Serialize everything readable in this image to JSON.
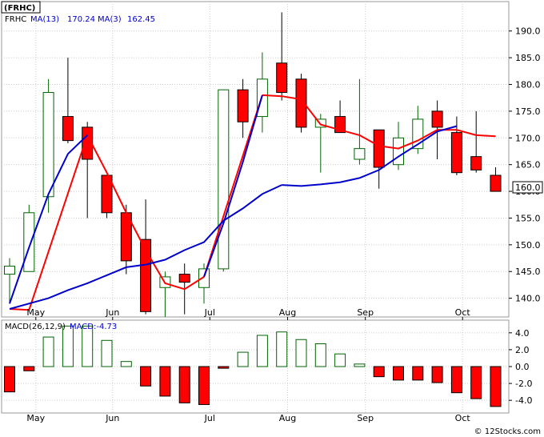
{
  "ticker_badge": "(FRHC)",
  "watermark": "© 12Stocks.com",
  "chart_data": [
    {
      "type": "candlestick",
      "legend": {
        "ticker": "FRHC",
        "ma13_label": "MA(13)",
        "ma13_value": "170.24",
        "ma3_label": "MA(3)",
        "ma3_value": "162.45"
      },
      "colors": {
        "up_fill": "#ffffff",
        "up_edge": "#006400",
        "down_fill": "#ff0000",
        "down_edge": "#000000",
        "ma3": "#ff0000",
        "ma13": "#0000cc"
      },
      "ylim": [
        136.5,
        195.5
      ],
      "yticks": [
        140.0,
        145.0,
        150.0,
        155.0,
        160.0,
        165.0,
        170.0,
        175.0,
        180.0,
        185.0,
        190.0
      ],
      "ytick_labels": [
        "140.0",
        "145.0",
        "150.0",
        "155.0",
        "160.0",
        "165.0",
        "170.0",
        "175.0",
        "180.0",
        "185.0",
        "190.0"
      ],
      "last_price": "160.0",
      "month_labels": [
        {
          "label": "May",
          "index": 1.35
        },
        {
          "label": "Jun",
          "index": 5.3
        },
        {
          "label": "Jul",
          "index": 10.3
        },
        {
          "label": "Aug",
          "index": 14.3
        },
        {
          "label": "Sep",
          "index": 18.3
        },
        {
          "label": "Oct",
          "index": 23.3
        }
      ],
      "candles": [
        {
          "o": 144.5,
          "h": 147.5,
          "l": 139.0,
          "c": 146.0
        },
        {
          "o": 145.0,
          "h": 157.5,
          "l": 145.0,
          "c": 156.0
        },
        {
          "o": 159.0,
          "h": 181.0,
          "l": 156.0,
          "c": 178.5
        },
        {
          "o": 174.0,
          "h": 185.0,
          "l": 169.0,
          "c": 169.5
        },
        {
          "o": 172.0,
          "h": 173.0,
          "l": 155.0,
          "c": 166.0
        },
        {
          "o": 163.0,
          "h": 163.0,
          "l": 155.0,
          "c": 156.0
        },
        {
          "o": 156.0,
          "h": 157.5,
          "l": 144.5,
          "c": 147.0
        },
        {
          "o": 151.0,
          "h": 158.5,
          "l": 137.0,
          "c": 137.5
        },
        {
          "o": 142.0,
          "h": 145.0,
          "l": 136.5,
          "c": 144.0
        },
        {
          "o": 144.5,
          "h": 146.5,
          "l": 137.0,
          "c": 143.0
        },
        {
          "o": 142.0,
          "h": 146.5,
          "l": 139.0,
          "c": 145.5
        },
        {
          "o": 145.5,
          "h": 179.0,
          "l": 145.0,
          "c": 179.0
        },
        {
          "o": 179.0,
          "h": 181.0,
          "l": 170.0,
          "c": 173.0
        },
        {
          "o": 174.0,
          "h": 186.0,
          "l": 171.0,
          "c": 181.0
        },
        {
          "o": 184.0,
          "h": 193.5,
          "l": 177.0,
          "c": 178.5
        },
        {
          "o": 181.0,
          "h": 182.0,
          "l": 171.0,
          "c": 172.0
        },
        {
          "o": 172.0,
          "h": 174.5,
          "l": 163.5,
          "c": 173.5
        },
        {
          "o": 174.0,
          "h": 177.0,
          "l": 171.0,
          "c": 171.0
        },
        {
          "o": 166.0,
          "h": 181.0,
          "l": 165.0,
          "c": 168.0
        },
        {
          "o": 171.5,
          "h": 171.5,
          "l": 160.5,
          "c": 164.5
        },
        {
          "o": 165.0,
          "h": 173.0,
          "l": 164.0,
          "c": 170.0
        },
        {
          "o": 168.0,
          "h": 176.0,
          "l": 167.0,
          "c": 173.5
        },
        {
          "o": 175.0,
          "h": 177.0,
          "l": 166.0,
          "c": 172.0
        },
        {
          "o": 171.0,
          "h": 174.0,
          "l": 163.0,
          "c": 163.5
        },
        {
          "o": 166.5,
          "h": 175.0,
          "l": 163.5,
          "c": 164.0
        },
        {
          "o": 163.0,
          "h": 164.5,
          "l": 160.0,
          "c": 160.0
        }
      ],
      "ma3": [
        138.0,
        137.8,
        null,
        null,
        170.5,
        163.5,
        156.0,
        149.0,
        142.8,
        141.7,
        144.0,
        null,
        null,
        178.0,
        177.8,
        177.2,
        172.5,
        171.5,
        170.5,
        168.5,
        168.0,
        169.5,
        171.5,
        171.5,
        170.5,
        170.3
      ],
      "ma13": [
        null,
        null,
        null,
        null,
        null,
        null,
        null,
        null,
        null,
        null,
        null,
        null,
        null,
        null,
        161.2,
        161.0,
        161.3,
        161.7,
        162.5,
        164.0,
        166.5,
        168.8,
        171.2,
        172.2,
        null,
        null
      ],
      "ma13_early": [
        139.0,
        149.5,
        159.5,
        167.0,
        170.5
      ],
      "ma13_mid": [
        {
          "i": 0,
          "v": 138.0
        },
        {
          "i": 2,
          "v": 140.0
        },
        {
          "i": 3,
          "v": 141.5
        },
        {
          "i": 4,
          "v": 142.8
        },
        {
          "i": 5,
          "v": 144.3
        },
        {
          "i": 6,
          "v": 145.8
        },
        {
          "i": 7,
          "v": 146.3
        },
        {
          "i": 8,
          "v": 147.2
        },
        {
          "i": 9,
          "v": 149.0
        },
        {
          "i": 10,
          "v": 150.5
        },
        {
          "i": 11,
          "v": 154.5
        },
        {
          "i": 12,
          "v": 156.8
        },
        {
          "i": 13,
          "v": 159.5
        },
        {
          "i": 14,
          "v": 161.2
        }
      ],
      "ma13_rise": [
        {
          "i": 10,
          "v": 144.0
        },
        {
          "i": 11,
          "v": 154.0
        },
        {
          "i": 12,
          "v": 165.5
        },
        {
          "i": 13,
          "v": 178.0
        }
      ]
    },
    {
      "type": "bar",
      "title": "MACD(26,12,9)",
      "value_label": "MACD:-4.73",
      "ylim": [
        -5.5,
        5.5
      ],
      "yticks": [
        4.0,
        2.0,
        0.0,
        -2.0,
        -4.0
      ],
      "ytick_labels": [
        "4.0",
        "2.0",
        "0.0",
        "-2.0",
        "-4.0"
      ],
      "values": [
        -3.0,
        -0.5,
        3.5,
        4.8,
        4.8,
        3.1,
        0.6,
        -2.3,
        -3.5,
        -4.3,
        -4.5,
        -0.2,
        1.7,
        3.7,
        4.1,
        3.2,
        2.7,
        1.5,
        0.3,
        -1.2,
        -1.6,
        -1.6,
        -1.9,
        -3.1,
        -3.8,
        -4.73
      ],
      "month_labels": [
        "May",
        "Jun",
        "Jul",
        "Aug",
        "Sep",
        "Oct"
      ]
    }
  ]
}
